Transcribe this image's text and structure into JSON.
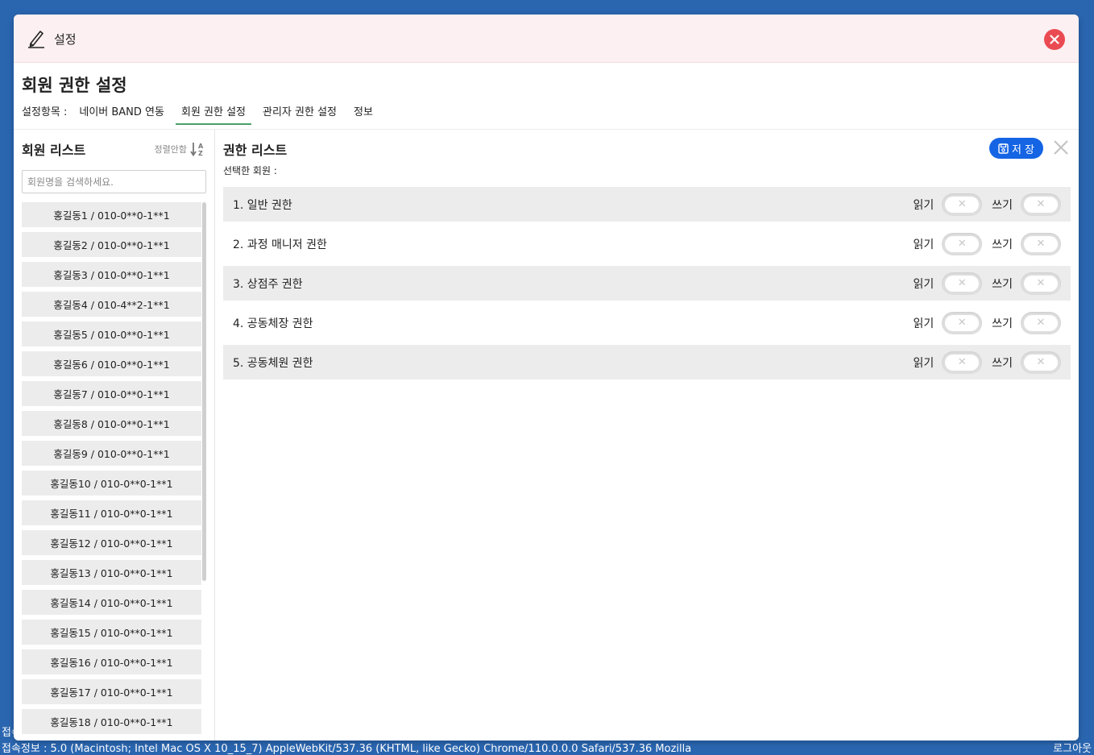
{
  "background": {
    "status_prefix": "접속",
    "status_text": "접속정보 : 5.0 (Macintosh; Intel Mac OS X 10_15_7) AppleWebKit/537.36 (KHTML, like Gecko) Chrome/110.0.0.0 Safari/537.36 Mozilla",
    "logout_label": "로그아웃"
  },
  "modal": {
    "title": "설정",
    "page_title": "회원 권한 설정",
    "tabs_label": "설정항목 :",
    "tabs": [
      {
        "label": "네이버 BAND 연동",
        "active": false
      },
      {
        "label": "회원 권한 설정",
        "active": true
      },
      {
        "label": "관리자 권한 설정",
        "active": false
      },
      {
        "label": "정보",
        "active": false
      }
    ]
  },
  "member_panel": {
    "title": "회원 리스트",
    "sort_label": "정렬안함",
    "search_placeholder": "회원명을 검색하세요.",
    "members": [
      "홍길동1 / 010-0**0-1**1",
      "홍길동2 / 010-0**0-1**1",
      "홍길동3 / 010-0**0-1**1",
      "홍길동4 / 010-4**2-1**1",
      "홍길동5 / 010-0**0-1**1",
      "홍길동6 / 010-0**0-1**1",
      "홍길동7 / 010-0**0-1**1",
      "홍길동8 / 010-0**0-1**1",
      "홍길동9 / 010-0**0-1**1",
      "홍길동10 / 010-0**0-1**1",
      "홍길동11 / 010-0**0-1**1",
      "홍길동12 / 010-0**0-1**1",
      "홍길동13 / 010-0**0-1**1",
      "홍길동14 / 010-0**0-1**1",
      "홍길동15 / 010-0**0-1**1",
      "홍길동16 / 010-0**0-1**1",
      "홍길동17 / 010-0**0-1**1",
      "홍길동18 / 010-0**0-1**1"
    ]
  },
  "permission_panel": {
    "title": "권한 리스트",
    "selected_label": "선택한 회원 :",
    "save_label": "저 장",
    "read_label": "읽기",
    "write_label": "쓰기",
    "permissions": [
      {
        "label": "1. 일반 권한",
        "read": false,
        "write": false
      },
      {
        "label": "2. 과정 매니저 권한",
        "read": false,
        "write": false
      },
      {
        "label": "3. 상점주 권한",
        "read": false,
        "write": false
      },
      {
        "label": "4. 공동체장 권한",
        "read": false,
        "write": false
      },
      {
        "label": "5. 공동체원 권한",
        "read": false,
        "write": false
      }
    ]
  },
  "colors": {
    "accent_blue": "#1464e4",
    "close_red": "#ea4b52",
    "active_tab_underline": "#4aa06a",
    "header_bg": "#fdf0f2",
    "desktop_bg": "#2a66b0"
  }
}
